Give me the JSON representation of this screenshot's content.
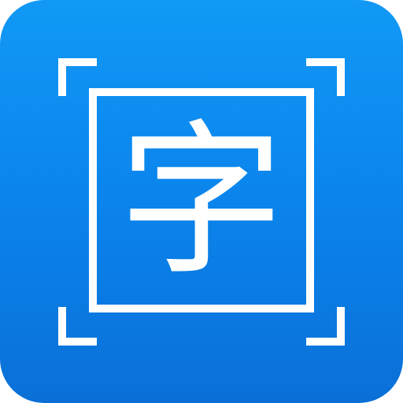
{
  "icon": {
    "character": "字",
    "background_top": "#1199f5",
    "background_bottom": "#0a70d8",
    "foreground": "#ffffff",
    "corner_marks": "scan-corner-brackets",
    "frame": "square-frame"
  }
}
